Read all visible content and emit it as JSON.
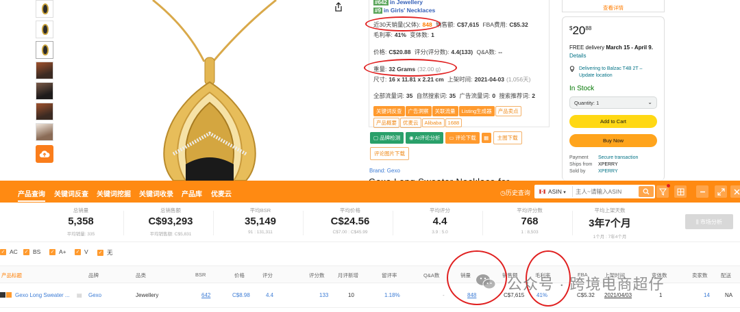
{
  "ranks": [
    {
      "badge": "#642",
      "label": "in Jewellery"
    },
    {
      "badge": "#9",
      "label": "in Girls' Necklaces"
    }
  ],
  "info": {
    "sales30_label": "近30天销量(父体):",
    "sales30_value": "848",
    "revenue_label": "销售额:",
    "revenue_value": "C$7,615",
    "fba_label": "FBA费用:",
    "fba_value": "C$5.32",
    "margin_label": "毛利率:",
    "margin_value": "41%",
    "variants_label": "变体数:",
    "variants_value": "1",
    "price_label": "价格:",
    "price_value": "C$20.88",
    "rating_label": "评分(评分数):",
    "rating_value": "4.4(133)",
    "qa_label": "Q&A数:",
    "qa_value": "--",
    "weight_label": "重量:",
    "weight_value": "32 Grams",
    "weight_extra": "(32.00 g)",
    "size_label": "尺寸:",
    "size_value": "16 x 11.81 x 2.21 cm",
    "listed_label": "上架时间:",
    "listed_value": "2021-04-03",
    "listed_extra": "(1,056天)",
    "kw_total_label": "全部流量词:",
    "kw_total_value": "35",
    "kw_natural_label": "自然搜索词:",
    "kw_natural_value": "35",
    "kw_ad_label": "广告流量词:",
    "kw_ad_value": "0",
    "kw_rec_label": "搜索推荐词:",
    "kw_rec_value": "2"
  },
  "tags": [
    {
      "label": "关键词反查",
      "solid": true
    },
    {
      "label": "广告洞察",
      "solid": true
    },
    {
      "label": "关联流量",
      "solid": true
    },
    {
      "label": "Listing生成器",
      "solid": true
    },
    {
      "label": "产品卖点",
      "solid": false
    },
    {
      "label": "产品概要",
      "solid": false
    },
    {
      "label": "优麦云",
      "solid": false
    },
    {
      "label": "Alibaba",
      "solid": false
    },
    {
      "label": "1688",
      "solid": false
    }
  ],
  "actions": {
    "check": "品牌检测",
    "ai": "AI评论分析",
    "review_dl": "评论下载",
    "main_img": "主图下载",
    "review_img": "评论图片下载"
  },
  "brand_line": "Brand: Gexo",
  "title_peek": "Gexo Long Sweater Necklace for",
  "buybox": {
    "top_link": "查看详情",
    "price_symbol": "$",
    "price_whole": "20",
    "price_frac": "88",
    "delivery_prefix": "FREE delivery",
    "delivery_date": "March 15 - April 9.",
    "details": "Details",
    "deliver_to": "Delivering to Balzac T4B 2T – Update location",
    "stock": "In Stock",
    "quantity": "Quantity: 1",
    "add_to_cart": "Add to Cart",
    "buy_now": "Buy Now",
    "payment_k": "Payment",
    "payment_v": "Secure transaction",
    "ships_k": "Ships from",
    "ships_v": "XPERRY",
    "sold_k": "Sold by",
    "sold_v": "XPERRY"
  },
  "toolbar": {
    "nav": [
      "产品查询",
      "关键词反查",
      "关键词挖掘",
      "关键词收录",
      "产品库",
      "优麦云"
    ],
    "history": "历史查询",
    "marketplace": "ASIN",
    "search_placeholder": "主人~请输入ASIN"
  },
  "stats": [
    {
      "label": "总销量",
      "value": "5,358",
      "sub": "平均销量: 335"
    },
    {
      "label": "总销售额",
      "value": "C$93,293",
      "sub": "平均销售额: C$5,831"
    },
    {
      "label": "平均BSR",
      "value": "35,149",
      "sub": "91 : 131,311"
    },
    {
      "label": "平均价格",
      "value": "C$24.56",
      "sub": "C$7.00 : C$45.99"
    },
    {
      "label": "平均评分",
      "value": "4.4",
      "sub": "3.9 : 5.0"
    },
    {
      "label": "平均评分数",
      "value": "768",
      "sub": "1 : 8,503"
    },
    {
      "label": "平均上架天数",
      "value": "3年7个月",
      "sub": "1个月 : 7年4个月"
    }
  ],
  "market_btn": "市场分析",
  "filters": [
    "AC",
    "BS",
    "A+",
    "V",
    "无"
  ],
  "table": {
    "headers": [
      "产品标题",
      "品牌",
      "品类",
      "BSR",
      "价格",
      "评分",
      "评分数",
      "月评新增",
      "留评率",
      "Q&A数",
      "销量",
      "销售额",
      "毛利率",
      "FBA",
      "上架时间",
      "变体数",
      "卖家数",
      "配送"
    ],
    "row": {
      "title": "Gexo Long Sweater ...",
      "brand": "Gexo",
      "category": "Jewellery",
      "bsr": "642",
      "price": "C$8.98",
      "rating": "4.4",
      "reviews": "133",
      "monthly": "10",
      "review_rate": "1.18%",
      "qa": "-",
      "sales": "848",
      "revenue": "C$7,615",
      "margin": "41%",
      "fba": "C$5.32",
      "listed": "2021/04/03",
      "variants": "1",
      "sellers": "14",
      "fulfil": "NA"
    }
  },
  "watermark": "公众号 · 跨境电商超仔"
}
